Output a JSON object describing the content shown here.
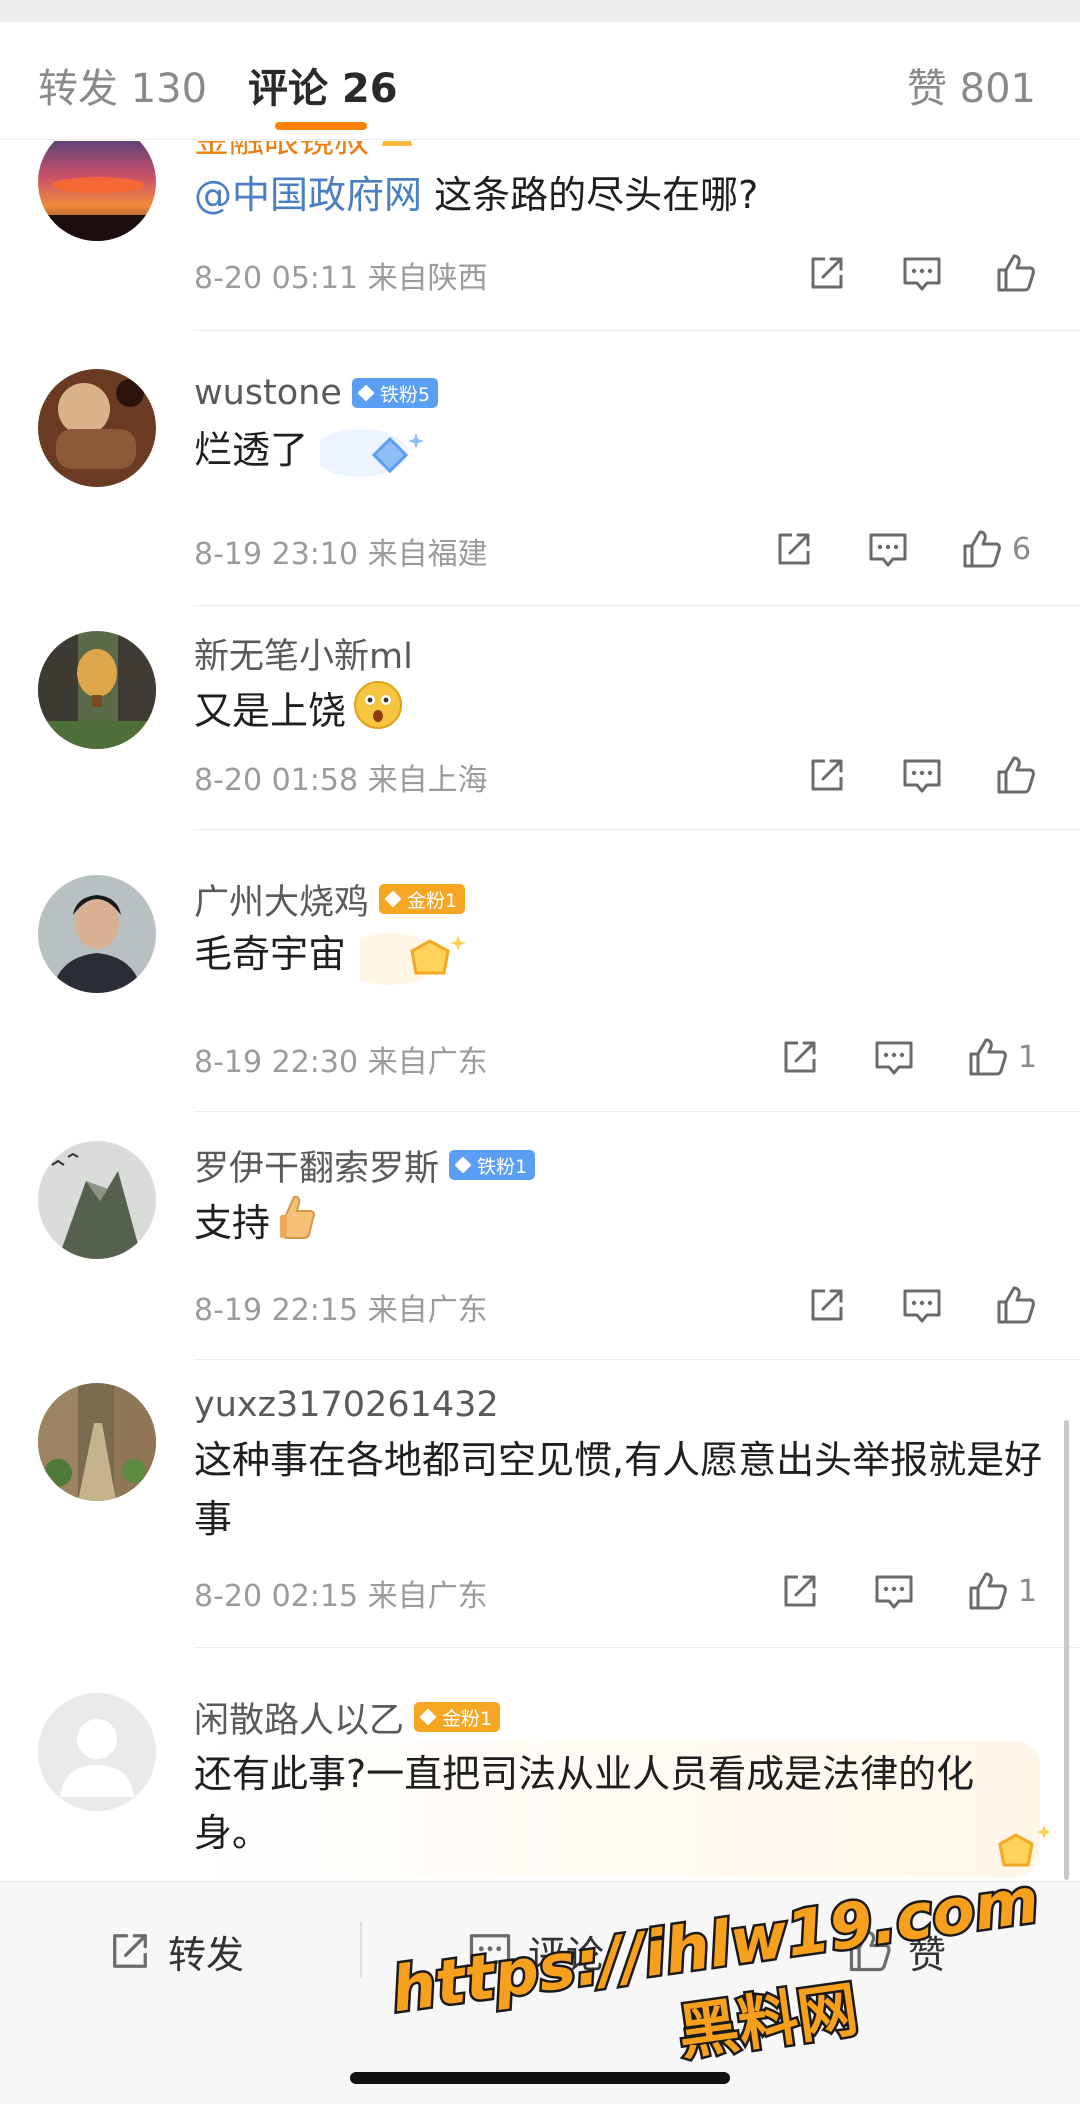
{
  "tabs": {
    "repost": "转发 130",
    "comments": "评论 26",
    "likes": "赞 801"
  },
  "comments": [
    {
      "name": "金融眼镜叔",
      "mention": "@中国政府网",
      "text": " 这条路的尽头在哪?",
      "meta": "8-20 05:11 来自陕西",
      "likes": ""
    },
    {
      "name": "wustone",
      "badge": "铁粉5",
      "text": "烂透了",
      "meta": "8-19 23:10 来自福建",
      "likes": "6"
    },
    {
      "name": "新无笔小新ml",
      "text": "又是上饶",
      "meta": "8-20 01:58 来自上海",
      "likes": ""
    },
    {
      "name": "广州大烧鸡",
      "badge": "金粉1",
      "text": "毛奇宇宙",
      "meta": "8-19 22:30 来自广东",
      "likes": "1"
    },
    {
      "name": "罗伊干翻索罗斯",
      "badge": "铁粉1",
      "text": "支持",
      "meta": "8-19 22:15 来自广东",
      "likes": ""
    },
    {
      "name": "yuxz3170261432",
      "text": "这种事在各地都司空见惯,有人愿意出头举报就是好事",
      "meta": "8-20 02:15 来自广东",
      "likes": "1"
    },
    {
      "name": "闲散路人以乙",
      "badge": "金粉1",
      "text": "还有此事?一直把司法从业人员看成是法律的化身。"
    }
  ],
  "bottom_bar": {
    "repost": "转发",
    "comment": "评论",
    "like": "赞"
  },
  "watermark": {
    "line1": "https://ihlw19.com",
    "line2": "黑料网"
  },
  "icons": [
    "share-icon",
    "reply-icon",
    "like-icon"
  ],
  "colors": {
    "accent": "#ff8200",
    "mention": "#4a7fc1",
    "iron_badge": "#5b9ff5",
    "gold_badge": "#f5a623",
    "meta_text": "#9b9b9b"
  }
}
